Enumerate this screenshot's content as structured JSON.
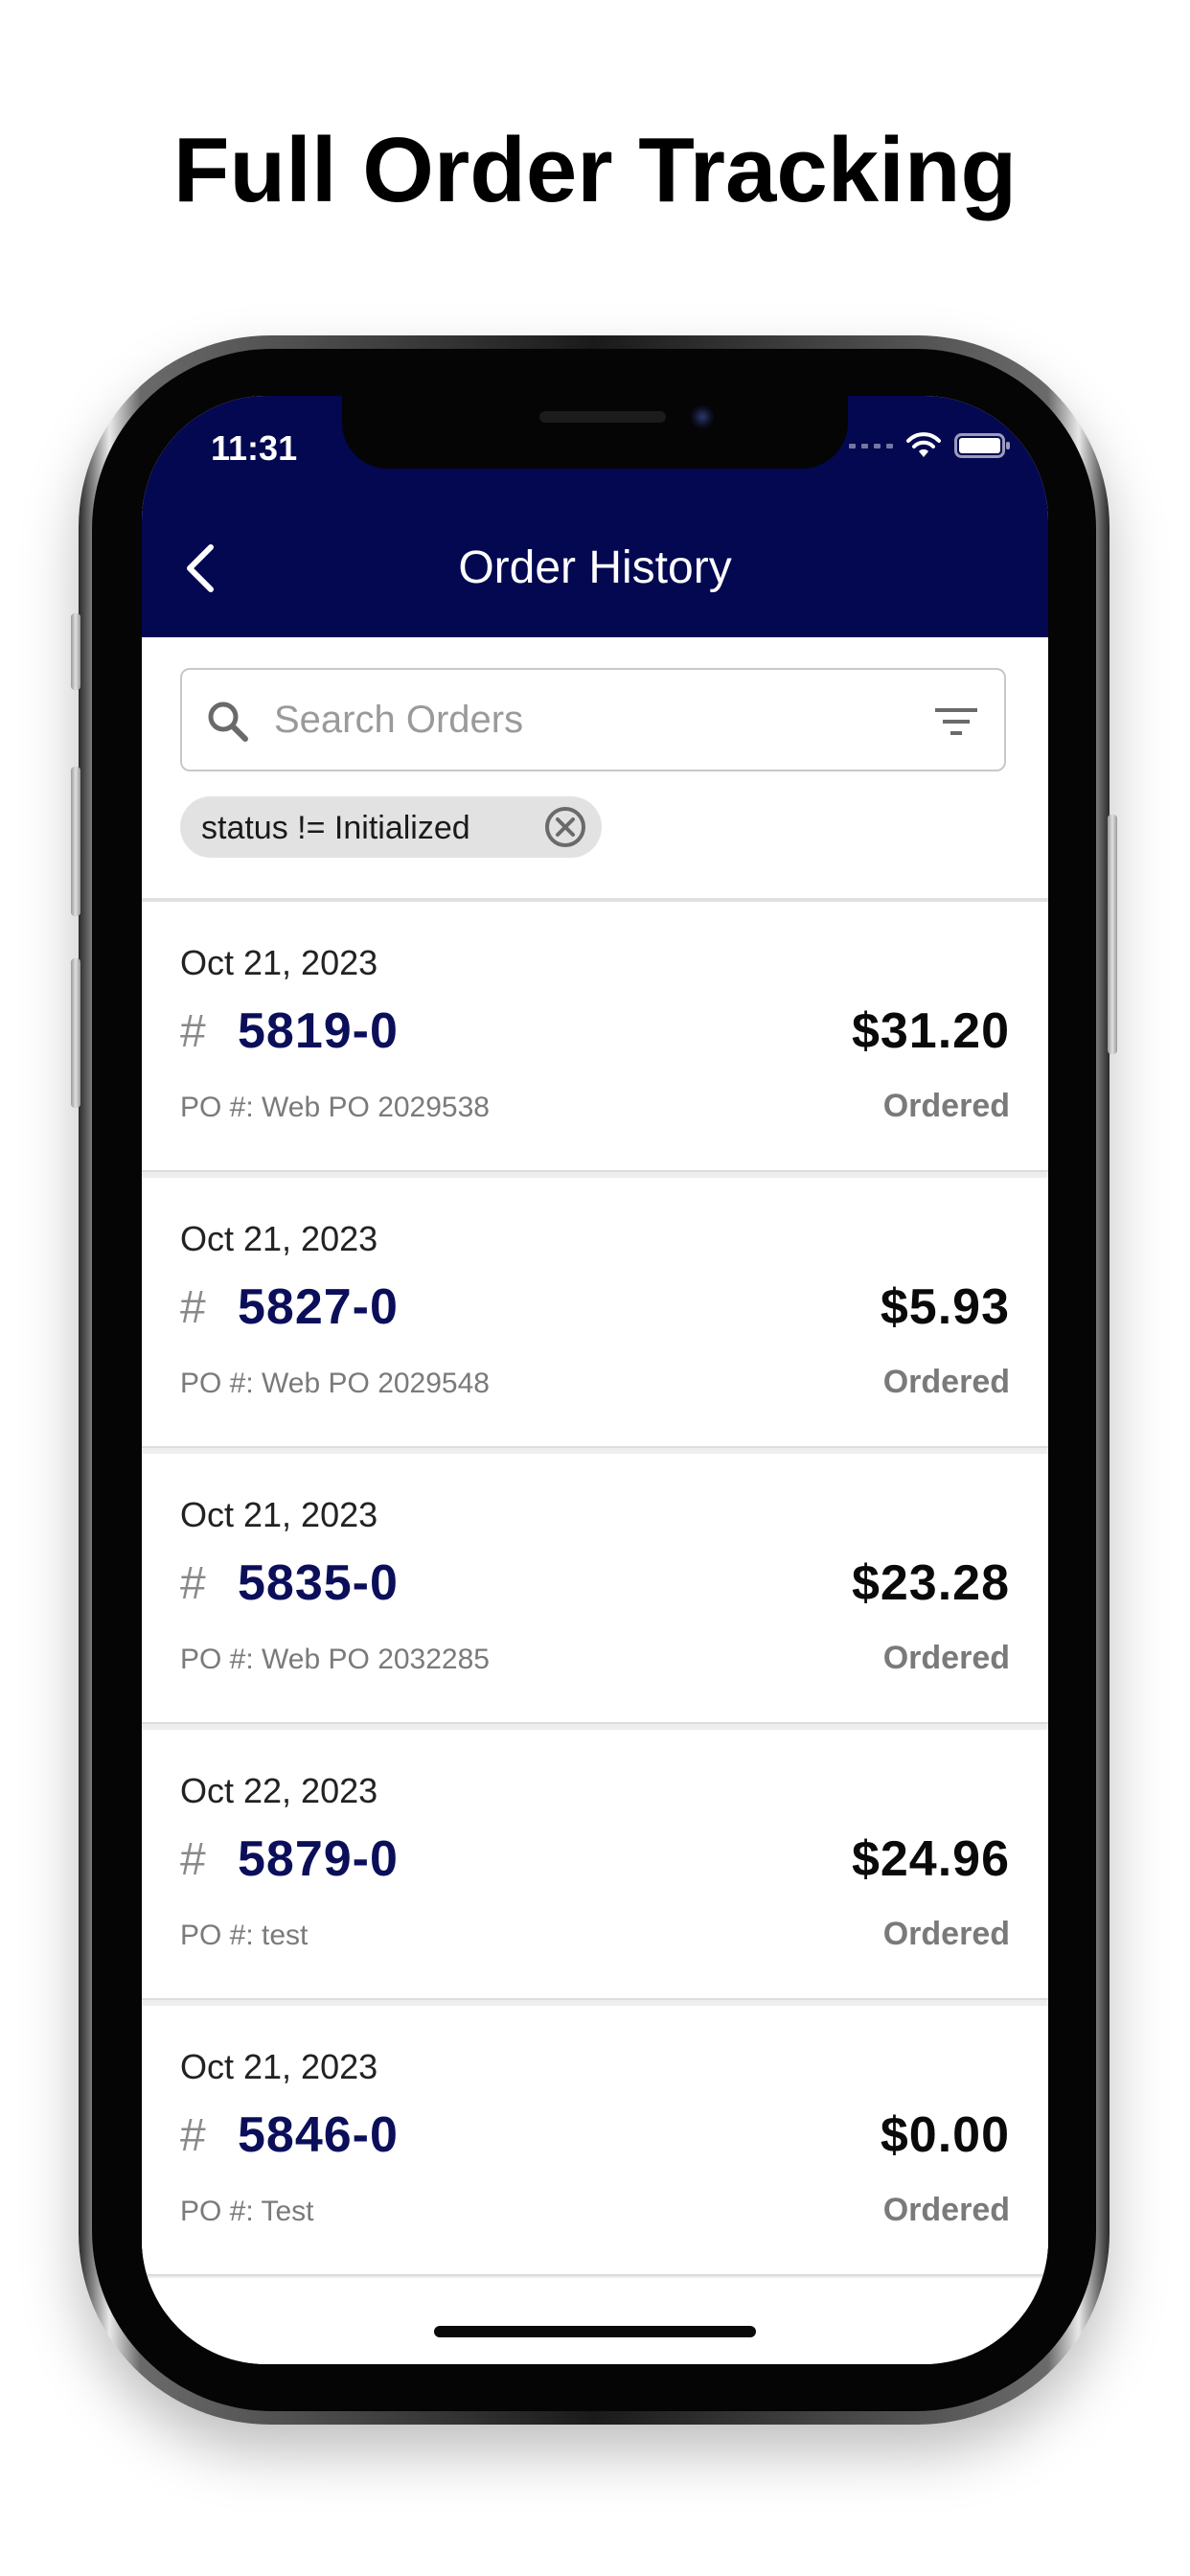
{
  "headline": "Full Order Tracking",
  "status_bar": {
    "time": "11:31"
  },
  "nav": {
    "title": "Order History"
  },
  "search": {
    "placeholder": "Search Orders",
    "value": ""
  },
  "filter_chip": {
    "label": "status != Initialized"
  },
  "orders": [
    {
      "date": "Oct 21, 2023",
      "hash": "#",
      "number": "5819-0",
      "amount": "$31.20",
      "po": "PO #: Web PO 2029538",
      "status": "Ordered"
    },
    {
      "date": "Oct 21, 2023",
      "hash": "#",
      "number": "5827-0",
      "amount": "$5.93",
      "po": "PO #: Web PO 2029548",
      "status": "Ordered"
    },
    {
      "date": "Oct 21, 2023",
      "hash": "#",
      "number": "5835-0",
      "amount": "$23.28",
      "po": "PO #: Web PO 2032285",
      "status": "Ordered"
    },
    {
      "date": "Oct 22, 2023",
      "hash": "#",
      "number": "5879-0",
      "amount": "$24.96",
      "po": "PO #: test",
      "status": "Ordered"
    },
    {
      "date": "Oct 21, 2023",
      "hash": "#",
      "number": "5846-0",
      "amount": "$0.00",
      "po": "PO #: Test",
      "status": "Ordered"
    }
  ],
  "colors": {
    "nav_background": "#030851",
    "order_number": "#0b0f5a",
    "status_text": "#7a7a7a",
    "chip_background": "#e2e2e2"
  },
  "icons": {
    "back": "chevron-left-icon",
    "search": "search-icon",
    "filter": "filter-icon",
    "chip_close": "close-circle-icon",
    "wifi": "wifi-icon",
    "battery": "battery-icon",
    "signal": "signal-icon"
  }
}
